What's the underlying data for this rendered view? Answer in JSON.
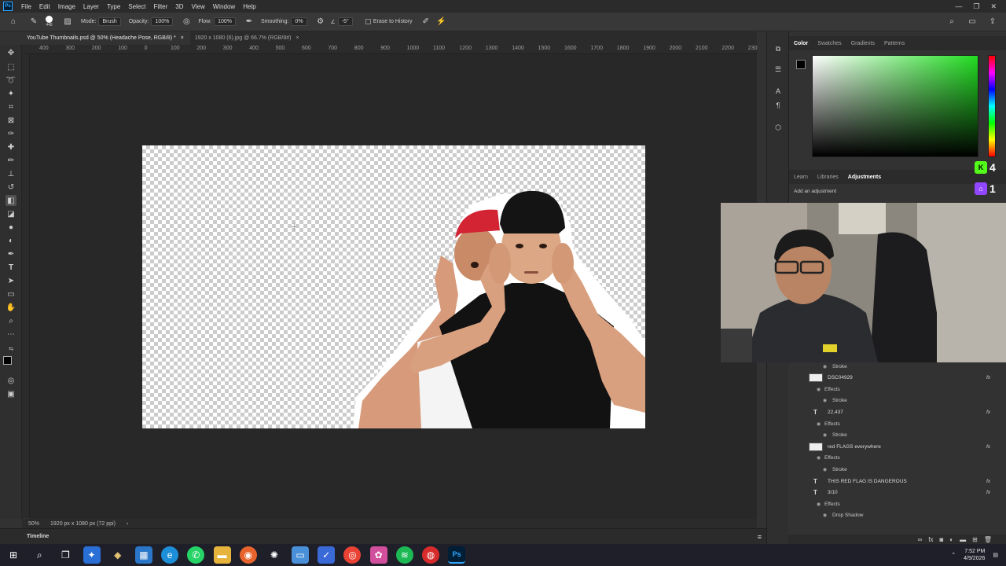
{
  "app": {
    "logo": "Ps"
  },
  "menu": [
    "File",
    "Edit",
    "Image",
    "Layer",
    "Type",
    "Select",
    "Filter",
    "3D",
    "View",
    "Window",
    "Help"
  ],
  "window_controls": {
    "minimize": "—",
    "restore": "❐",
    "close": "✕"
  },
  "options": {
    "brush_size": "448",
    "mode_label": "Mode:",
    "mode_value": "Brush",
    "opacity_label": "Opacity:",
    "opacity_value": "100%",
    "flow_label": "Flow:",
    "flow_value": "100%",
    "smoothing_label": "Smoothing:",
    "smoothing_value": "0%",
    "angle_value": "-5°",
    "erase_history_label": "Erase to History"
  },
  "tabs": [
    {
      "label": "YouTube Thumbnails.psd @ 50% (Headache Pose, RGB/8) *",
      "close": "×"
    },
    {
      "label": "1920 x 1080 (6).jpg @ 66.7% (RGB/8#)",
      "close": "×"
    }
  ],
  "ruler": [
    "400",
    "300",
    "200",
    "100",
    "0",
    "100",
    "200",
    "300",
    "400",
    "500",
    "600",
    "700",
    "800",
    "900",
    "1000",
    "1100",
    "1200",
    "1300",
    "1400",
    "1500",
    "1600",
    "1700",
    "1800",
    "1900",
    "2000",
    "2100",
    "2200",
    "230"
  ],
  "status": {
    "zoom": "50%",
    "doc_size": "1920 px x 1080 px (72 ppi)",
    "arrow": "›"
  },
  "timeline": {
    "label": "Timeline"
  },
  "color_panel": {
    "tabs": [
      "Color",
      "Swatches",
      "Gradients",
      "Patterns"
    ],
    "active": "Color"
  },
  "adjust_panel": {
    "tabs": [
      "Learn",
      "Libraries",
      "Adjustments"
    ],
    "active": "Adjustments",
    "hint": "Add an adjustment"
  },
  "stream_counters": [
    {
      "label": "K",
      "count": "4",
      "color": "#53fc18"
    },
    {
      "label": "⌂",
      "count": "1",
      "color": "#9146ff"
    }
  ],
  "layers": [
    {
      "kind": "sub",
      "text": "Stroke"
    },
    {
      "kind": "layer",
      "type": "image",
      "text": "DSC04929",
      "fx": "fx"
    },
    {
      "kind": "effects",
      "text": "Effects"
    },
    {
      "kind": "sub",
      "text": "Stroke"
    },
    {
      "kind": "layer",
      "type": "text",
      "text": "22,437",
      "fx": "fx"
    },
    {
      "kind": "effects",
      "text": "Effects"
    },
    {
      "kind": "sub",
      "text": "Stroke"
    },
    {
      "kind": "layer",
      "type": "image",
      "text": "red FLAGS everywhere",
      "fx": "fx"
    },
    {
      "kind": "effects",
      "text": "Effects"
    },
    {
      "kind": "sub",
      "text": "Stroke"
    },
    {
      "kind": "layer",
      "type": "text",
      "text": "THIS RED FLAG IS DANGEROUS",
      "fx": "fx"
    },
    {
      "kind": "layer",
      "type": "text",
      "text": "3/10",
      "fx": "fx"
    },
    {
      "kind": "effects",
      "text": "Effects"
    },
    {
      "kind": "sub",
      "text": "Drop Shadow"
    }
  ],
  "clock": {
    "time": "7:52 PM",
    "date": "4/9/2026"
  },
  "colors": {
    "accent": "#31a8ff",
    "kick": "#53fc18",
    "twitch": "#9146ff"
  }
}
